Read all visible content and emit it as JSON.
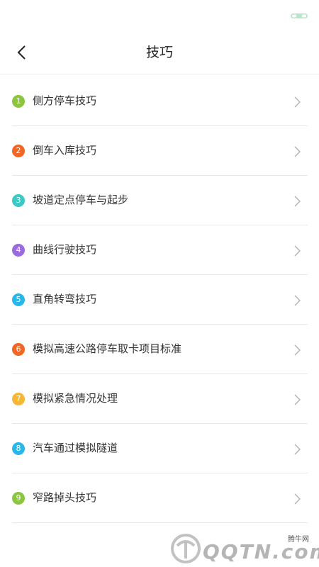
{
  "header": {
    "title": "技巧",
    "back_icon": "chevron-left-icon"
  },
  "list": {
    "items": [
      {
        "num": "1",
        "label": "侧方停车技巧",
        "color": "#8cc63f"
      },
      {
        "num": "2",
        "label": "倒车入库技巧",
        "color": "#f26522"
      },
      {
        "num": "3",
        "label": "坡道定点停车与起步",
        "color": "#3cc9c4"
      },
      {
        "num": "4",
        "label": "曲线行驶技巧",
        "color": "#9b6bde"
      },
      {
        "num": "5",
        "label": "直角转弯技巧",
        "color": "#29b6e8"
      },
      {
        "num": "6",
        "label": "模拟高速公路停车取卡项目标准",
        "color": "#f26522"
      },
      {
        "num": "7",
        "label": "模拟紧急情况处理",
        "color": "#f7b733"
      },
      {
        "num": "8",
        "label": "汽车通过模拟隧道",
        "color": "#29b6e8"
      },
      {
        "num": "9",
        "label": "窄路掉头技巧",
        "color": "#8cc63f"
      }
    ],
    "chevron_icon": "chevron-right-icon"
  },
  "watermark": {
    "small_text": "腾牛网",
    "logo_text": "QQTN.com"
  }
}
